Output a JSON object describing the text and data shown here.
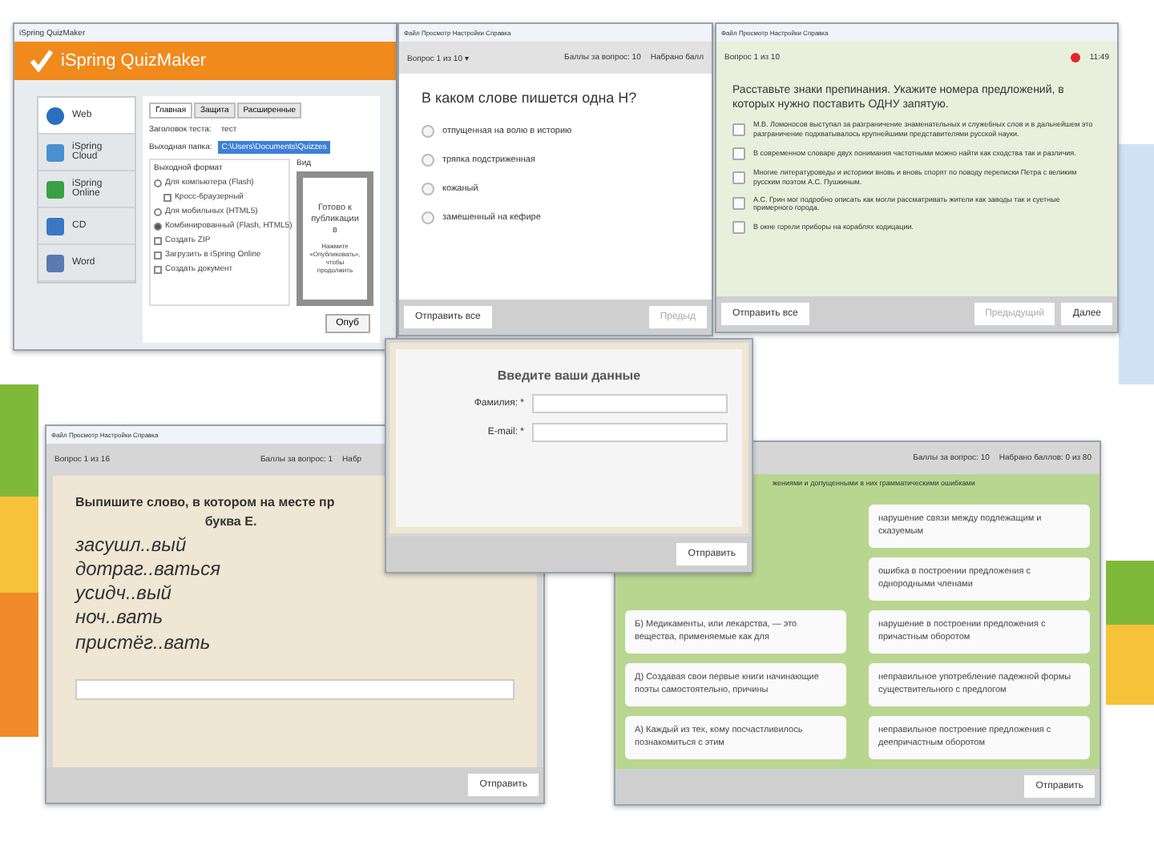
{
  "quizmaker": {
    "title": "iSpring QuizMaker",
    "brand": "iSpring QuizMaker",
    "sidebar": [
      {
        "label": "Web",
        "selected": true
      },
      {
        "label": "iSpring Cloud",
        "selected": false
      },
      {
        "label": "iSpring Online",
        "selected": false
      },
      {
        "label": "CD",
        "selected": false
      },
      {
        "label": "Word",
        "selected": false
      }
    ],
    "tabs": [
      {
        "label": "Главная",
        "selected": true
      },
      {
        "label": "Защита",
        "selected": false
      },
      {
        "label": "Расширенные",
        "selected": false
      }
    ],
    "fields": [
      {
        "label": "Заголовок теста:",
        "value": "тест"
      },
      {
        "label": "Выходная папка:",
        "value": "C:\\Users\\Documents\\Quizzes"
      }
    ],
    "format_group": "Выходной формат",
    "options": [
      {
        "kind": "radio",
        "label": "Для компьютера (Flash)",
        "checked": false
      },
      {
        "kind": "checkbox",
        "label": "Кросс-браузерный",
        "checked": false
      },
      {
        "kind": "radio",
        "label": "Для мобильных (HTML5)",
        "checked": false
      },
      {
        "kind": "radio",
        "label": "Комбинированный (Flash, HTML5)",
        "checked": true
      },
      {
        "kind": "checkbox",
        "label": "Создать ZIP",
        "checked": false
      },
      {
        "kind": "checkbox",
        "label": "Загрузить в iSpring Online",
        "checked": false
      },
      {
        "kind": "checkbox",
        "label": "Создать документ",
        "checked": false
      }
    ],
    "preview_label": "Вид",
    "preview_title": "Готово к публикации в",
    "preview_text": "Нажмите «Опубликовать», чтобы продолжить",
    "button": "Опуб"
  },
  "choice_quiz": {
    "menu": "Файл  Просмотр  Настройки  Справка",
    "question_no": "Вопрос 1 из 10 ▾",
    "points": "Баллы за вопрос: 10",
    "scored": "Набрано балл",
    "question": "В каком слове пишется одна Н?",
    "answers": [
      {
        "label": "отпущенная на волю в историю",
        "selected": false
      },
      {
        "label": "тряпка подстриженная",
        "selected": false
      },
      {
        "label": "кожаный",
        "selected": false
      },
      {
        "label": "замешенный на кефире",
        "selected": false
      }
    ],
    "submit_all": "Отправить все",
    "prev": "Предыд"
  },
  "punctuation_quiz": {
    "menu": "Файл  Просмотр  Настройки  Справка",
    "question_no": "Вопрос 1 из 10",
    "timer": "11:49",
    "question": "Расставьте знаки препинания. Укажите номера предложений, в которых нужно поставить ОДНУ запятую.",
    "answers": [
      {
        "label": "М.В. Ломоносов выступал за разграничение знаменательных и служебных слов и в дальнейшем это разграничение подхватывалось крупнейшими представителями русской науки.",
        "checked": false
      },
      {
        "label": "В современном словаре двух понимания частотными можно найти как сходства так и различия.",
        "checked": false
      },
      {
        "label": "Многие литературоведы и историки вновь и вновь спорят по поводу переписки Петра с великим русским поэтом А.С. Пушкиным.",
        "checked": false
      },
      {
        "label": "А.С. Грин мог подробно описать как могли рассматривать жители как заводы так и суетные примерного города.",
        "checked": false
      },
      {
        "label": "В окне горели приборы на кораблях кодицации.",
        "checked": false
      }
    ],
    "submit_all": "Отправить все",
    "prev": "Предыдущий",
    "next": "Далее"
  },
  "data_form": {
    "title": "Введите ваши данные",
    "fields": [
      {
        "label": "Фамилия: *"
      },
      {
        "label": "E-mail: *"
      }
    ],
    "button": "Отправить"
  },
  "spelling_quiz": {
    "menu": "Файл  Просмотр  Настройки  Справка",
    "question_no": "Вопрос 1 из 16",
    "points": "Баллы за вопрос: 1",
    "scored": "Набр",
    "question": "Выпишите слово, в котором на месте пр",
    "question_end": "буква Е.",
    "words": [
      "засушл..вый",
      "дотраг..ваться",
      "усидч..вый",
      "ноч..вать",
      "пристёг..вать"
    ],
    "button": "Отправить"
  },
  "matching_quiz": {
    "points": "Баллы за вопрос: 10",
    "scored": "Набрано баллов: 0 из 80",
    "instruction": "жениями и допущенными в них грамматическими ошибками",
    "left": [
      "Б) Медикаменты, или лекарства, — это вещества, применяемые как для",
      "Д) Создавая свои первые книги начинающие поэты самостоятельно, причины",
      "А) Каждый из тех, кому посчастливилось познакомиться с этим"
    ],
    "right": [
      "нарушение связи между подлежащим и сказуемым",
      "ошибка в построении предложения с однородными членами",
      "нарушение в построении предложения с причастным оборотом",
      "неправильное употребление падежной формы существительного с предлогом",
      "неправильное построение предложения с деепричастным оборотом"
    ],
    "button": "Отправить"
  }
}
